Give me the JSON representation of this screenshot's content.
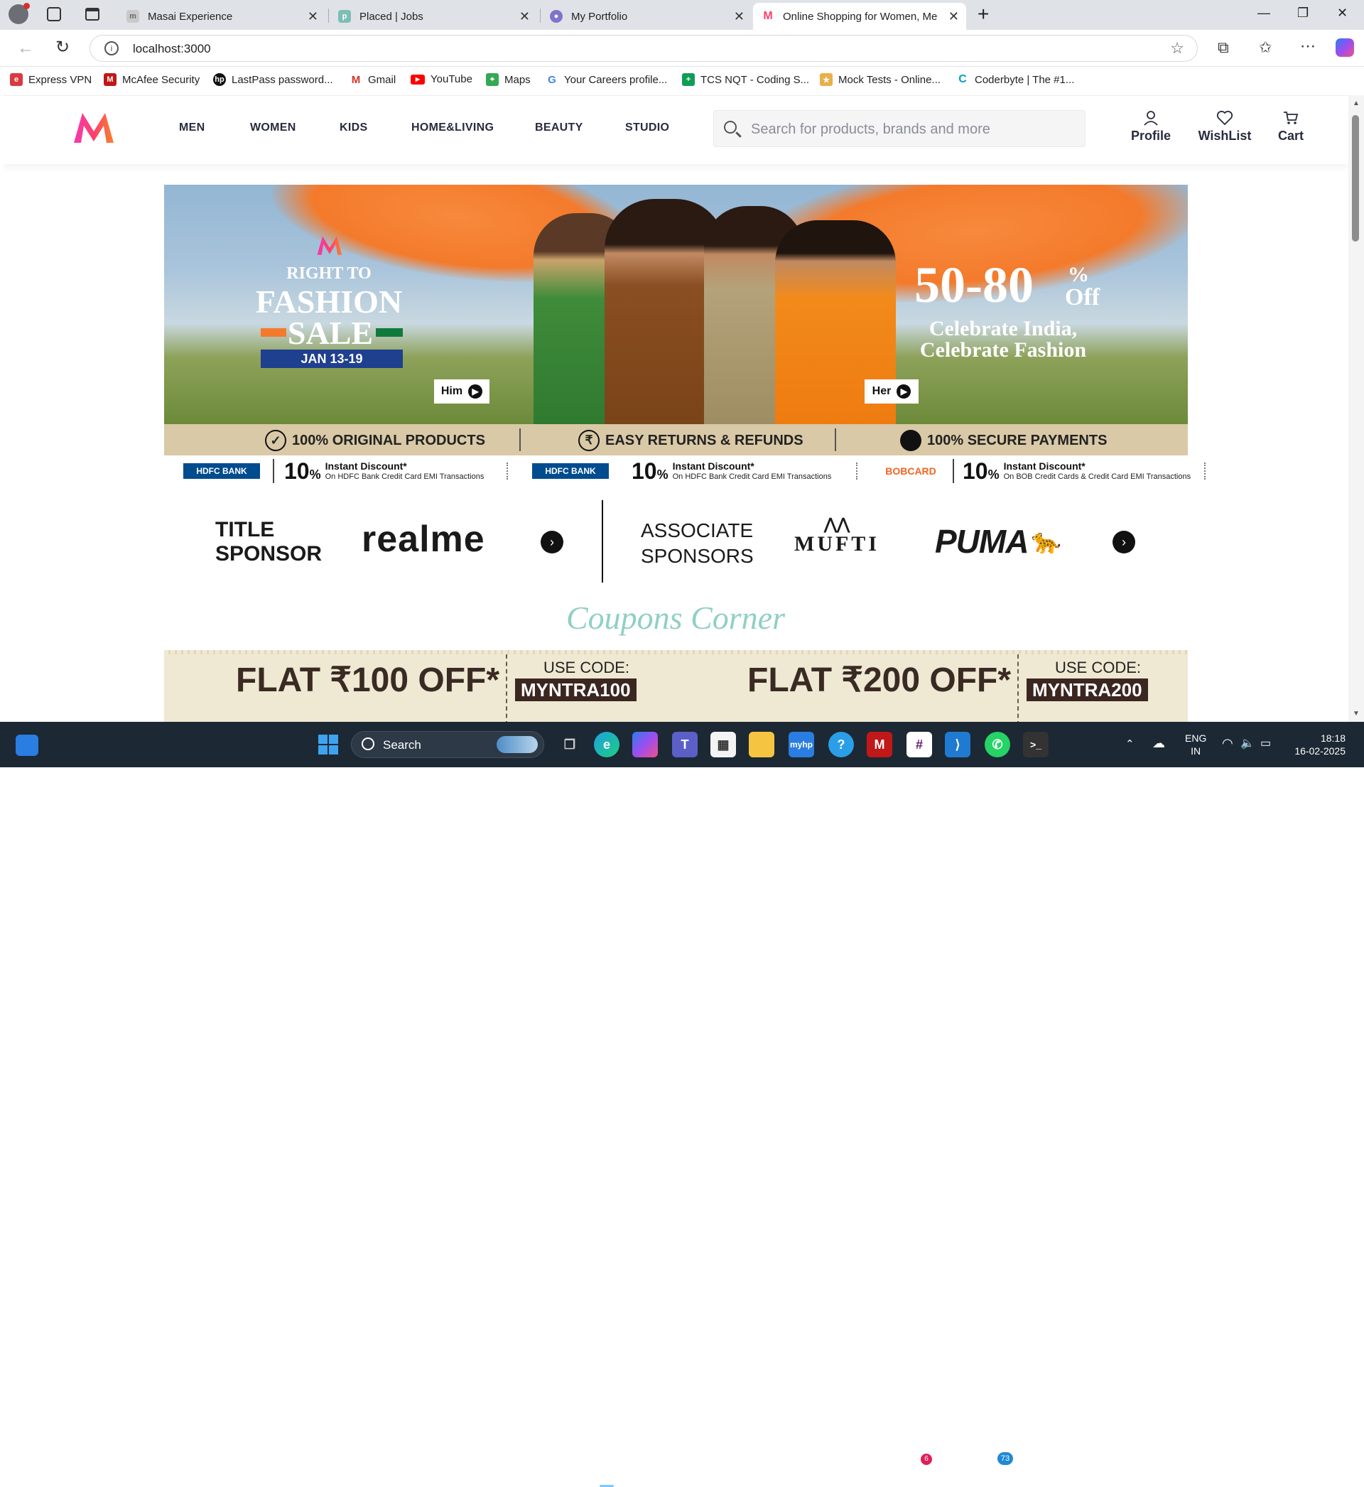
{
  "browser": {
    "tabs": [
      {
        "title": "Masai Experience",
        "icon": "m-letter-icon"
      },
      {
        "title": "Placed | Jobs",
        "icon": "placed-icon"
      },
      {
        "title": "My Portfolio",
        "icon": "portfolio-icon"
      },
      {
        "title": "Online Shopping for Women, Me",
        "icon": "myntra-icon",
        "active": true
      }
    ],
    "url": "localhost:3000",
    "bookmarks": [
      {
        "label": "Express VPN",
        "color": "#da3940"
      },
      {
        "label": "McAfee Security",
        "color": "#c01818"
      },
      {
        "label": "LastPass password...",
        "color": "#111111"
      },
      {
        "label": "Gmail",
        "color": "#d93025"
      },
      {
        "label": "YouTube",
        "color": "#ff0000"
      },
      {
        "label": "Maps",
        "color": "#34a853"
      },
      {
        "label": "Your Careers profile...",
        "color": "#4285f4"
      },
      {
        "label": "TCS NQT - Coding S...",
        "color": "#0f9d58"
      },
      {
        "label": "Mock Tests - Online...",
        "color": "#e8b04a"
      },
      {
        "label": "Coderbyte | The #1...",
        "color": "#00a3c4"
      }
    ]
  },
  "site": {
    "nav": [
      "MEN",
      "WOMEN",
      "KIDS",
      "HOME&LIVING",
      "BEAUTY",
      "STUDIO"
    ],
    "search_placeholder": "Search for products, brands and more",
    "actions": {
      "profile": "Profile",
      "wishlist": "WishList",
      "cart": "Cart"
    },
    "brand_colors": {
      "pink": "#ff3f6c",
      "orange": "#f7832b",
      "dark": "#282c3f"
    }
  },
  "banner": {
    "line1": "RIGHT TO",
    "line2": "FASHION",
    "line3": "SALE",
    "dates": "JAN 13-19",
    "discount": "50-80",
    "pct": "%",
    "off": "Off",
    "tag1": "Celebrate India,",
    "tag2": "Celebrate Fashion",
    "him": "Him",
    "her": "Her"
  },
  "trust": [
    "100% ORIGINAL PRODUCTS",
    "EASY RETURNS & REFUNDS",
    "100% SECURE PAYMENTS"
  ],
  "offers": [
    {
      "bank": "HDFC BANK",
      "pct": "10",
      "unit": "%",
      "title": "Instant Discount*",
      "detail": "On HDFC Bank Credit Card EMI Transactions",
      "color": "#004c8f"
    },
    {
      "bank": "HDFC BANK",
      "pct": "10",
      "unit": "%",
      "title": "Instant Discount*",
      "detail": "On HDFC Bank Credit Card EMI Transactions",
      "color": "#004c8f"
    },
    {
      "bank": "BOBCARD",
      "pct": "10",
      "unit": "%",
      "title": "Instant Discount*",
      "detail": "On BOB Credit Cards & Credit Card EMI Transactions",
      "color": "#f26522"
    }
  ],
  "sponsors": {
    "title_l1": "TITLE",
    "title_l2": "SPONSOR",
    "title_brand": "realme",
    "assoc_l1": "ASSOCIATE",
    "assoc_l2": "SPONSORS",
    "assoc_brands": [
      "MUFTI",
      "PUMA"
    ]
  },
  "coupons": {
    "heading": "Coupons Corner",
    "items": [
      {
        "flat": "FLAT ₹100 OFF*",
        "use": "USE CODE:",
        "code": "MYNTRA100"
      },
      {
        "flat": "FLAT ₹200 OFF*",
        "use": "USE CODE:",
        "code": "MYNTRA200"
      }
    ]
  },
  "taskbar": {
    "search": "Search",
    "lang1": "ENG",
    "lang2": "IN",
    "time": "18:18",
    "date": "16-02-2025",
    "badge_slack": "6",
    "badge_whatsapp": "73"
  }
}
